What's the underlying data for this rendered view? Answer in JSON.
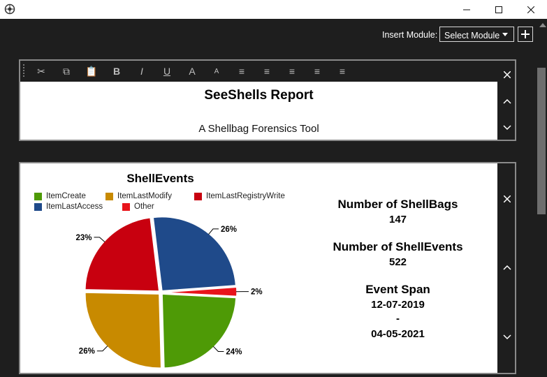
{
  "window": {
    "controls": {
      "minimize": "—",
      "maximize": "☐",
      "close": "✕"
    }
  },
  "toolbar": {
    "insert_label": "Insert Module:",
    "select_value": "Select Module",
    "add_label": "+"
  },
  "editor_module": {
    "buttons": [
      {
        "name": "cut-icon",
        "glyph": "✂"
      },
      {
        "name": "copy-icon",
        "glyph": "⧉"
      },
      {
        "name": "paste-icon",
        "glyph": "📋"
      },
      {
        "name": "bold-icon",
        "glyph": "B"
      },
      {
        "name": "italic-icon",
        "glyph": "I"
      },
      {
        "name": "underline-icon",
        "glyph": "U"
      },
      {
        "name": "increase-font-icon",
        "glyph": "A"
      },
      {
        "name": "decrease-font-icon",
        "glyph": "A"
      },
      {
        "name": "bullet-list-icon",
        "glyph": "≡"
      },
      {
        "name": "align-left-icon",
        "glyph": "≡"
      },
      {
        "name": "align-center-icon",
        "glyph": "≡"
      },
      {
        "name": "align-right-icon",
        "glyph": "≡"
      },
      {
        "name": "justify-icon",
        "glyph": "≡"
      }
    ],
    "title": "SeeShells Report",
    "subtitle": "A Shellbag Forensics Tool"
  },
  "stats": {
    "shellbags_label": "Number of ShellBags",
    "shellbags_value": "147",
    "shellevents_label": "Number of ShellEvents",
    "shellevents_value": "522",
    "span_label": "Event Span",
    "span_start": "12-07-2019",
    "span_sep": "-",
    "span_end": "04-05-2021"
  },
  "chart_data": {
    "type": "pie",
    "title": "ShellEvents",
    "legend": "top",
    "slices": [
      {
        "label": "ItemLastAccess",
        "value": 26,
        "color": "#1f4a8a",
        "display": "26%"
      },
      {
        "label": "Other",
        "value": 2,
        "color": "#e8141b",
        "display": "2%"
      },
      {
        "label": "ItemCreate",
        "value": 24,
        "color": "#4e9a06",
        "display": "24%"
      },
      {
        "label": "ItemLastModify",
        "value": 26,
        "color": "#c88a00",
        "display": "26%"
      },
      {
        "label": "ItemLastRegistryWrite",
        "value": 23,
        "color": "#c8000f",
        "display": "23%"
      }
    ],
    "legend_order": [
      "ItemCreate",
      "ItemLastModify",
      "ItemLastRegistryWrite",
      "ItemLastAccess",
      "Other"
    ]
  }
}
